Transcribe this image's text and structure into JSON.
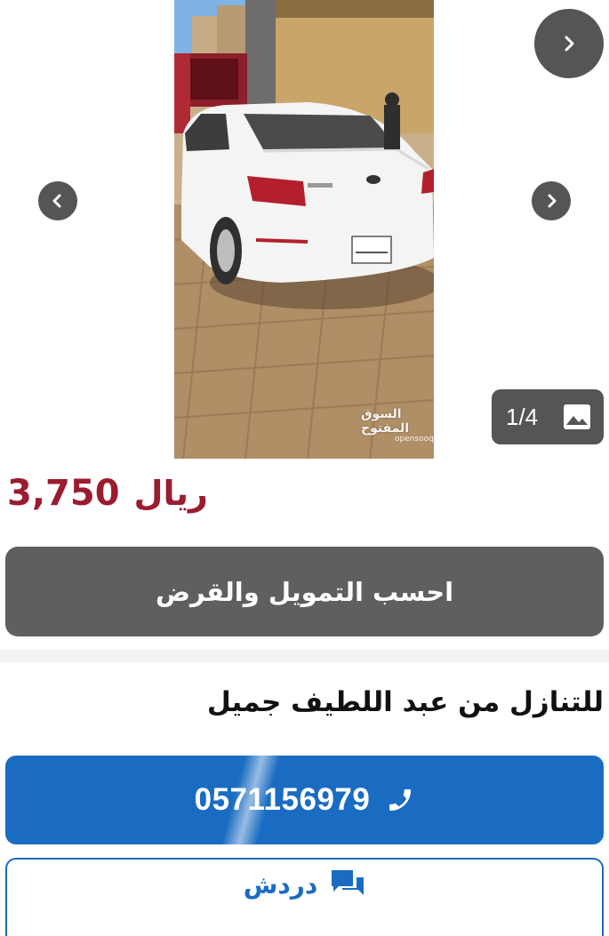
{
  "gallery": {
    "counter": "1/4",
    "watermark_ar": "السوق المفتوح",
    "watermark_en": "opensooq",
    "icons": {
      "top_next": "chevron-right-icon",
      "prev": "chevron-left-icon",
      "next": "chevron-right-icon",
      "counter": "image-icon"
    }
  },
  "listing": {
    "price_value": "3,750",
    "price_currency": "ريال",
    "finance_label": "احسب التمويل والقرض",
    "seller_text": "للتنازل من عبد اللطيف جميل"
  },
  "actions": {
    "call_number": "0571156979",
    "call_icon": "phone-icon",
    "chat_label": "دردش",
    "chat_icon": "chat-icon"
  },
  "colors": {
    "price": "#9b1b2f",
    "finance_button": "#5f5f5f",
    "primary": "#1a6cc2",
    "nav_button": "#555555"
  }
}
